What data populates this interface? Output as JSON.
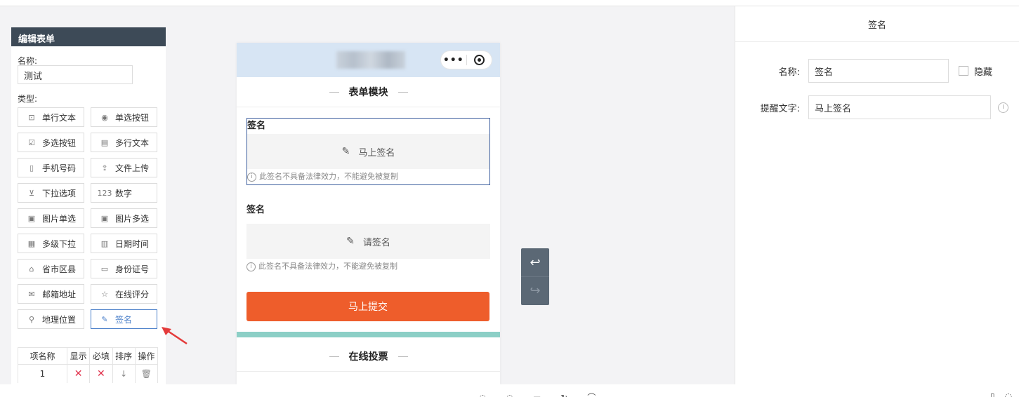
{
  "editor": {
    "title": "编辑表单",
    "name_label": "名称:",
    "name_value": "测试",
    "type_label": "类型:",
    "types": [
      {
        "label": "单行文本",
        "icon": "single-line-text-icon",
        "glyph": "⊡"
      },
      {
        "label": "单选按钮",
        "icon": "radio-icon",
        "glyph": "◉"
      },
      {
        "label": "多选按钮",
        "icon": "checkbox-icon",
        "glyph": "☑"
      },
      {
        "label": "多行文本",
        "icon": "multi-line-text-icon",
        "glyph": "▤"
      },
      {
        "label": "手机号码",
        "icon": "phone-icon",
        "glyph": "▯"
      },
      {
        "label": "文件上传",
        "icon": "upload-icon",
        "glyph": "⇪"
      },
      {
        "label": "下拉选项",
        "icon": "dropdown-icon",
        "glyph": "⊻"
      },
      {
        "label": "数字",
        "icon": "number-icon",
        "glyph": "123"
      },
      {
        "label": "图片单选",
        "icon": "image-single-icon",
        "glyph": "▣"
      },
      {
        "label": "图片多选",
        "icon": "image-multi-icon",
        "glyph": "▣"
      },
      {
        "label": "多级下拉",
        "icon": "cascade-icon",
        "glyph": "▦"
      },
      {
        "label": "日期时间",
        "icon": "calendar-icon",
        "glyph": "▥"
      },
      {
        "label": "省市区县",
        "icon": "region-icon",
        "glyph": "⌂"
      },
      {
        "label": "身份证号",
        "icon": "id-card-icon",
        "glyph": "▭"
      },
      {
        "label": "邮箱地址",
        "icon": "mail-icon",
        "glyph": "✉"
      },
      {
        "label": "在线评分",
        "icon": "star-icon",
        "glyph": "☆"
      },
      {
        "label": "地理位置",
        "icon": "location-icon",
        "glyph": "⚲"
      },
      {
        "label": "签名",
        "icon": "signature-pen-icon",
        "glyph": "✎"
      }
    ],
    "table": {
      "headers": [
        "项名称",
        "显示",
        "必填",
        "排序",
        "操作"
      ],
      "row": {
        "name": "1",
        "show": "✕",
        "required": "✕",
        "sort": "↓",
        "op": "🗑"
      }
    }
  },
  "phone": {
    "capsule_dots": "•••",
    "section1_title": "表单模块",
    "sig1": {
      "label": "签名",
      "action": "马上签名",
      "note": "此签名不具备法律效力，不能避免被复制"
    },
    "sig2": {
      "label": "签名",
      "action": "请签名",
      "note": "此签名不具备法律效力，不能避免被复制"
    },
    "submit_label": "马上提交",
    "section2_title": "在线投票"
  },
  "history": {
    "undo": "↩",
    "redo": "↪"
  },
  "props": {
    "title": "签名",
    "name_label": "名称:",
    "name_value": "签名",
    "hide_label": "隐藏",
    "hint_label": "提醒文字:",
    "hint_value": "马上签名"
  },
  "colors": {
    "accent": "#4a7fc9",
    "submit": "#ee5d2b",
    "header": "#3d4a57",
    "teal": "#8ccfc6"
  }
}
